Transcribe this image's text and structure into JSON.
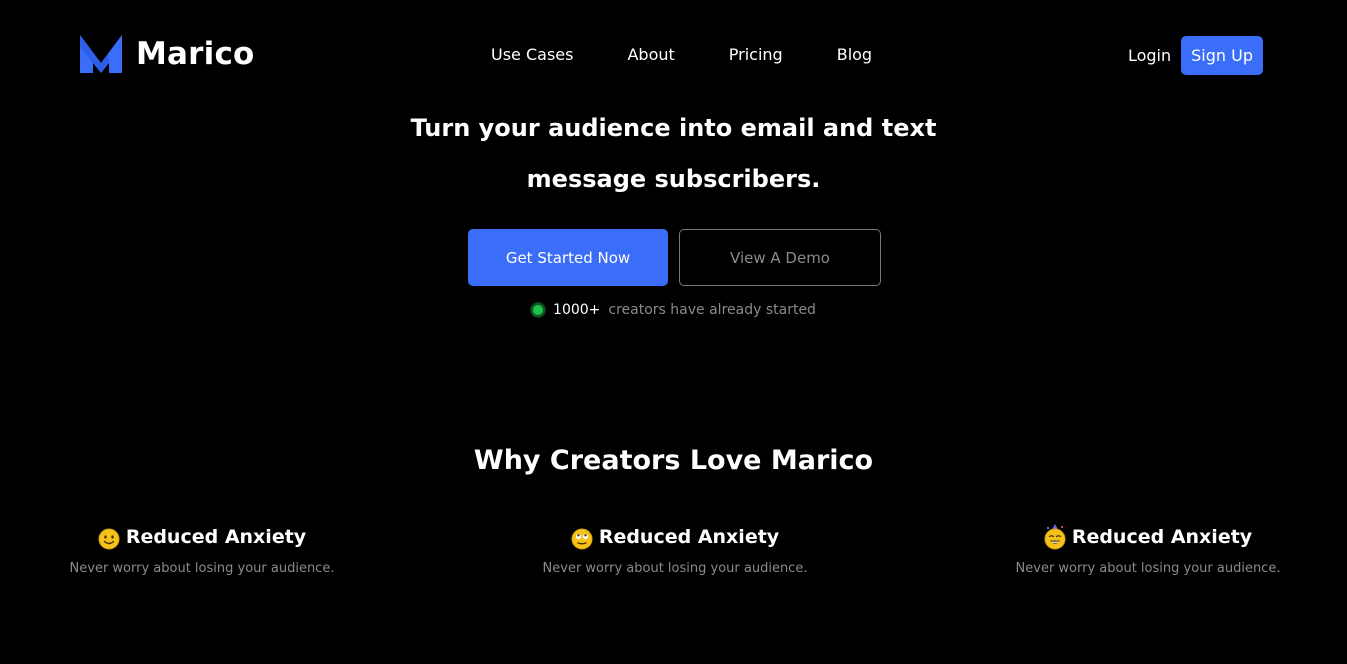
{
  "brand": {
    "name": "Marico",
    "logo_icon": "marico-m-logo-icon",
    "accent_color": "#3b6ef8"
  },
  "nav": {
    "items": [
      {
        "label": "Use Cases"
      },
      {
        "label": "About"
      },
      {
        "label": "Pricing"
      },
      {
        "label": "Blog"
      }
    ]
  },
  "auth": {
    "login_label": "Login",
    "signup_label": "Sign Up"
  },
  "hero": {
    "title_line1": "Turn your audience into email and text",
    "title_line2": "message subscribers.",
    "primary_cta": "Get Started Now",
    "secondary_cta": "View A Demo",
    "social_count": "1000+",
    "social_label": "creators have already started",
    "status_color": "#1ec24a"
  },
  "features": {
    "section_title": "Why Creators Love Marico",
    "items": [
      {
        "icon": "smiling-face-icon",
        "title": "Reduced Anxiety",
        "description": "Never worry about losing your audience."
      },
      {
        "icon": "rolling-eyes-face-icon",
        "title": "Reduced Anxiety",
        "description": "Never worry about losing your audience."
      },
      {
        "icon": "party-face-icon",
        "title": "Reduced Anxiety",
        "description": "Never worry about losing your audience."
      }
    ]
  }
}
